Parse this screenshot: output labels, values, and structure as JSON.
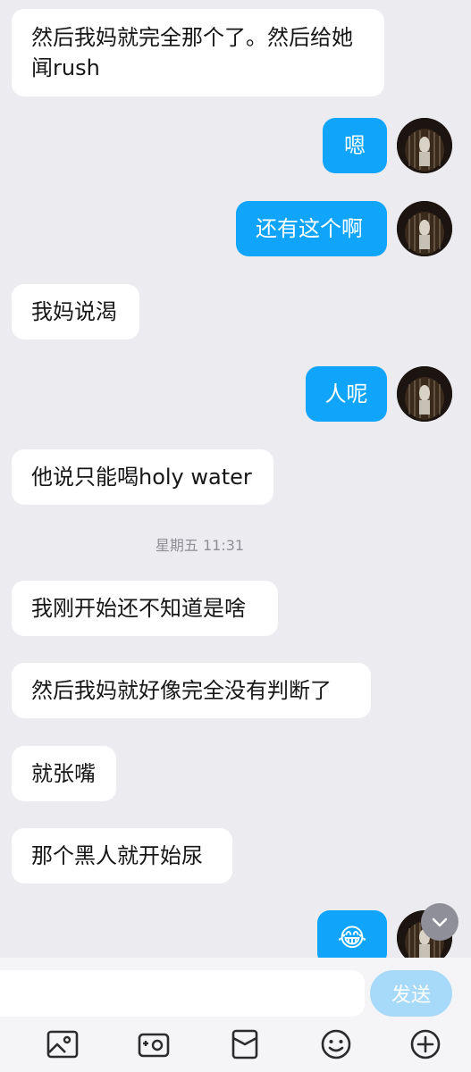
{
  "messages": [
    {
      "side": "in",
      "text": "然后我妈就完全那个了。然后给她闻rush"
    },
    {
      "side": "out",
      "text": "嗯"
    },
    {
      "side": "out",
      "text": "还有这个啊"
    },
    {
      "side": "in",
      "text": "我妈说渴"
    },
    {
      "side": "out",
      "text": "人呢"
    },
    {
      "side": "in",
      "text": "他说只能喝holy water"
    },
    {
      "side": "in",
      "text": "我刚开始还不知道是啥"
    },
    {
      "side": "in",
      "text": "然后我妈就好像完全没有判断了"
    },
    {
      "side": "in",
      "text": "就张嘴"
    },
    {
      "side": "in",
      "text": "那个黑人就开始尿"
    },
    {
      "side": "out",
      "text": "😂"
    }
  ],
  "timestamp": "星期五 11:31",
  "composer": {
    "placeholder": "",
    "send_label": "发送"
  },
  "toolbar": {
    "icons": [
      "image-icon",
      "camera-icon",
      "red-packet-icon",
      "emoji-icon",
      "plus-icon"
    ]
  },
  "colors": {
    "outgoing_bubble": "#10a5fb",
    "incoming_bubble": "#ffffff",
    "background": "#ececf0",
    "send_button": "#a7d9f9"
  }
}
